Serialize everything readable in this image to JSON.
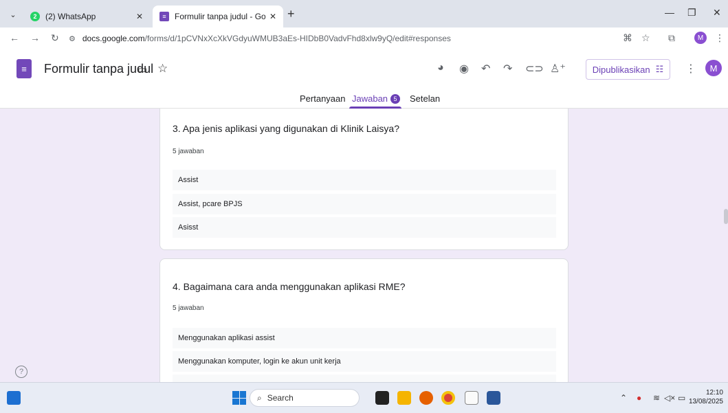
{
  "browser": {
    "tabs": [
      {
        "title": "(2) WhatsApp",
        "badge": "2"
      },
      {
        "title": "Formulir tanpa judul - Google F"
      }
    ],
    "url_host": "docs.google.com",
    "url_path": "/forms/d/1pCVNxXcXkVGdyuWMUB3aEs-HIDbB0VadvFhd8xlw9yQ/edit#responses",
    "profile_initial": "M"
  },
  "form": {
    "title": "Formulir tanpa judul",
    "publish_label": "Dipublikasikan",
    "account_initial": "M",
    "tabs": {
      "questions": "Pertanyaan",
      "responses": "Jawaban",
      "responses_count": "5",
      "settings": "Setelan"
    }
  },
  "questions": [
    {
      "title": "3. Apa jenis aplikasi yang digunakan di Klinik Laisya?",
      "count": "5 jawaban",
      "answers": [
        "Assist",
        "Assist, pcare BPJS",
        "Asisst"
      ]
    },
    {
      "title": "4. Bagaimana cara anda menggunakan aplikasi RME?",
      "count": "5 jawaban",
      "answers": [
        "Menggunakan aplikasi assist",
        "Menggunakan komputer, login ke akun unit kerja",
        ""
      ]
    }
  ],
  "taskbar": {
    "search_placeholder": "Search",
    "time": "12:10",
    "date": "13/08/2025"
  }
}
